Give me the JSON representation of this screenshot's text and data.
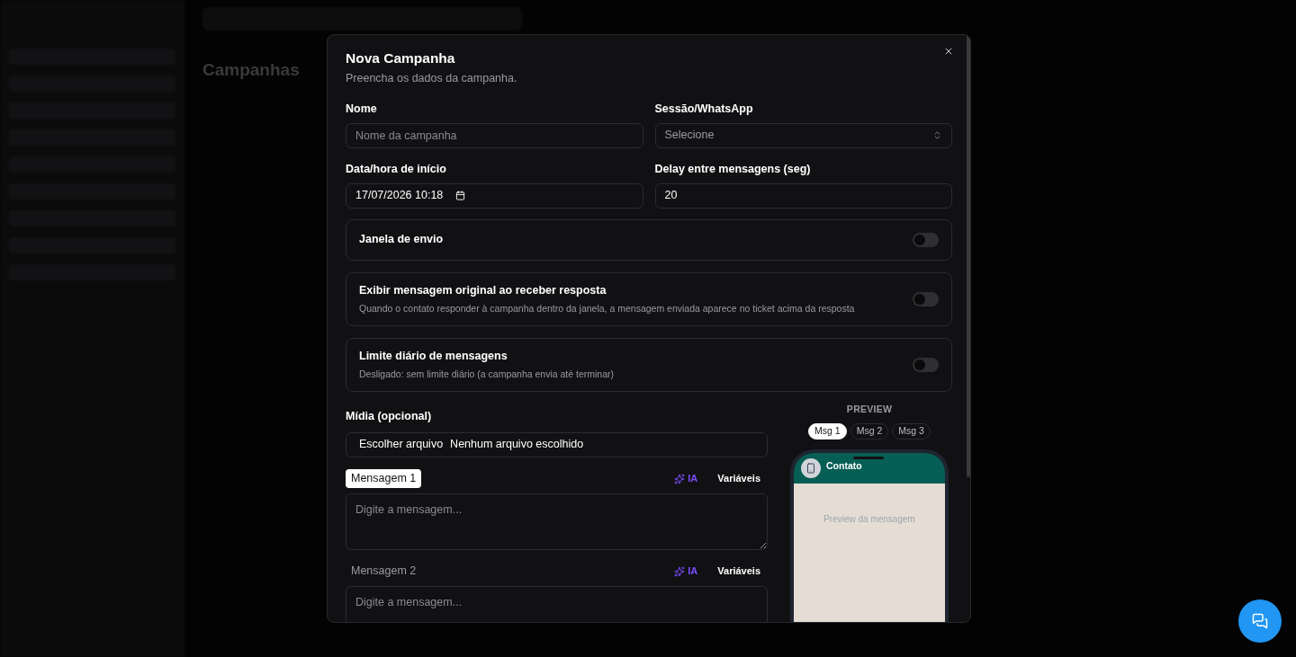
{
  "background": {
    "page_title": "Campanhas"
  },
  "dialog": {
    "title": "Nova Campanha",
    "subtitle": "Preencha os dados da campanha.",
    "fields": [
      {
        "kind": "text",
        "label": "Nome",
        "placeholder": "Nome da campanha"
      },
      {
        "kind": "select",
        "label": "Sessão/WhatsApp",
        "placeholder": "Selecione"
      },
      {
        "kind": "datetime",
        "label": "Data/hora de início",
        "value": "17/07/2026 10:18"
      },
      {
        "kind": "number",
        "label": "Delay entre mensagens (seg)",
        "value": "20"
      }
    ],
    "toggles": [
      {
        "title": "Janela de envio",
        "on": false
      },
      {
        "title": "Exibir mensagem original ao receber resposta",
        "description": "Quando o contato responder à campanha dentro da janela, a mensagem enviada aparece no ticket acima da resposta",
        "on": false
      },
      {
        "title": "Limite diário de mensagens",
        "description": "Desligado: sem limite diário (a campanha envia até terminar)",
        "on": false
      }
    ],
    "media": {
      "label": "Mídia (opcional)",
      "button": "Escolher arquivo",
      "status": "Nenhum arquivo escolhido"
    },
    "messages": [
      {
        "label": "Mensagem 1",
        "selected": true,
        "ai": "IA",
        "variables": "Variáveis",
        "placeholder": "Digite a mensagem..."
      },
      {
        "label": "Mensagem 2",
        "selected": false,
        "ai": "IA",
        "variables": "Variáveis",
        "placeholder": "Digite a mensagem..."
      }
    ],
    "preview": {
      "heading": "PREVIEW",
      "tabs": [
        {
          "label": "Msg 1",
          "selected": true
        },
        {
          "label": "Msg 2",
          "selected": false
        },
        {
          "label": "Msg 3",
          "selected": false
        }
      ],
      "contact": "Contato",
      "placeholder": "Preview da mensagem"
    }
  }
}
